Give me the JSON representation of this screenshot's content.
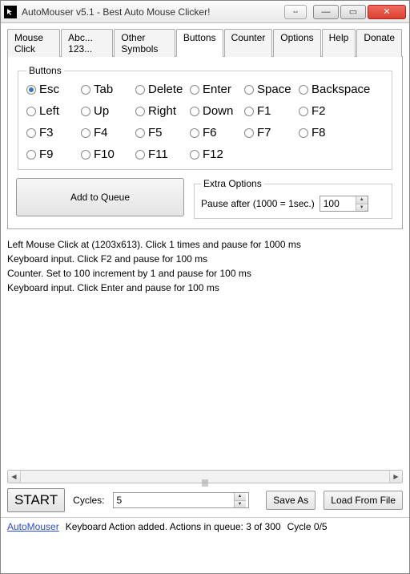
{
  "window": {
    "title": "AutoMouser v5.1 - Best Auto Mouse Clicker!"
  },
  "tabs": [
    {
      "label": "Mouse Click"
    },
    {
      "label": "Abc... 123..."
    },
    {
      "label": "Other Symbols"
    },
    {
      "label": "Buttons"
    },
    {
      "label": "Counter"
    },
    {
      "label": "Options"
    },
    {
      "label": "Help"
    },
    {
      "label": "Donate"
    }
  ],
  "active_tab": "Buttons",
  "buttons_group": {
    "legend": "Buttons",
    "selected": "Esc",
    "options": [
      "Esc",
      "Tab",
      "Delete",
      "Enter",
      "Space",
      "Backspace",
      "Left",
      "Up",
      "Right",
      "Down",
      "F1",
      "F2",
      "F3",
      "F4",
      "F5",
      "F6",
      "F7",
      "F8",
      "F9",
      "F10",
      "F11",
      "F12"
    ]
  },
  "add_queue_label": "Add to Queue",
  "extra_options": {
    "legend": "Extra Options",
    "pause_label": "Pause after (1000 = 1sec.)",
    "pause_value": "100"
  },
  "queue_items": [
    "Left Mouse Click at  (1203x613). Click 1 times and pause for 1000 ms",
    "Keyboard input. Click F2 and pause for 100 ms",
    "Counter. Set to 100 increment by 1 and pause for 100 ms",
    "Keyboard input. Click Enter and pause for 100 ms"
  ],
  "bottom": {
    "start_label": "START",
    "cycles_label": "Cycles:",
    "cycles_value": "5",
    "save_as_label": "Save As",
    "load_label": "Load From File"
  },
  "status": {
    "link": "AutoMouser",
    "message": "Keyboard Action added. Actions in queue: 3 of 300",
    "cycle": "Cycle 0/5"
  }
}
